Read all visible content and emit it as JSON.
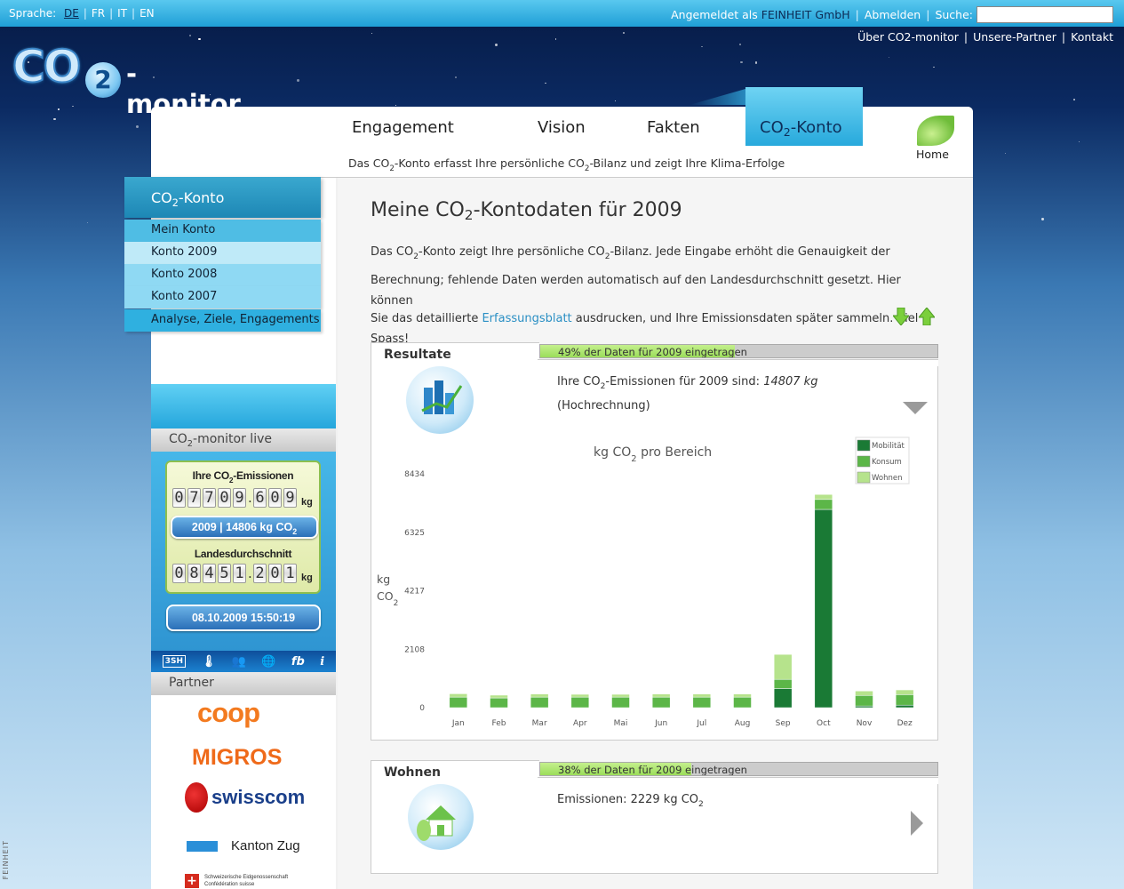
{
  "topbar": {
    "language_label": "Sprache:",
    "languages": [
      "DE",
      "FR",
      "IT",
      "EN"
    ],
    "logged_in_prefix": "Angemeldet als",
    "user": "FEINHEIT GmbH",
    "logout": "Abmelden",
    "search_label": "Suche:",
    "search_value": ""
  },
  "toplinks": [
    "Über CO2-monitor",
    "Unsere-Partner",
    "Kontakt"
  ],
  "logo": {
    "co": "CO",
    "two": "2",
    "monitor": "-monitor"
  },
  "nav": {
    "items": [
      "Engagement",
      "Vision",
      "Fakten"
    ],
    "active_prefix": "CO",
    "active_sub": "2",
    "active_suffix": "-Konto",
    "tagline": {
      "a": "Das CO",
      "b": "2",
      "c": "-Konto erfasst Ihre persönliche CO",
      "d": "2",
      "e": "-Bilanz und zeigt Ihre Klima-Erfolge"
    },
    "home": "Home"
  },
  "sidebar": {
    "head_a": "CO",
    "head_b": "2",
    "head_c": "-Konto",
    "items": [
      "Mein Konto",
      "Konto 2009",
      "Konto 2008",
      "Konto 2007",
      "Analyse, Ziele, Engagements"
    ]
  },
  "live": {
    "head_a": "CO",
    "head_b": "2",
    "head_c": "-monitor live",
    "emissions_title_a": "Ihre CO",
    "emissions_title_b": "2",
    "emissions_title_c": "-Emissionen",
    "emissions_digits": [
      "0",
      "7",
      "7",
      "0",
      "9",
      ".",
      "6",
      "0",
      "9"
    ],
    "unit": "kg",
    "year_pill_a": "2009 | 14806 kg CO",
    "year_pill_b": "2",
    "avg_title": "Landesdurchschnitt",
    "avg_digits": [
      "0",
      "8",
      "4",
      "5",
      "1",
      ".",
      "2",
      "0",
      "1"
    ],
    "date": "08.10.2009 15:50:19",
    "icons": [
      "3SH",
      "thermometer-icon",
      "people-icon",
      "globe-icon",
      "fb",
      "i"
    ]
  },
  "partners": {
    "head": "Partner",
    "logos": [
      "coop",
      "MIGROS",
      "swisscom",
      "Kanton Zug",
      "Schweizerische Eidgenossenschaft",
      "Confédération suisse"
    ]
  },
  "footer_vertical": "FEINHEIT",
  "main": {
    "title_a": "Meine CO",
    "title_b": "2",
    "title_c": "-Kontodaten für 2009",
    "intro_1a": "Das CO",
    "intro_1b": "2",
    "intro_1c": "-Konto zeigt Ihre persönliche CO",
    "intro_1d": "2",
    "intro_1e": "-Bilanz. Jede Eingabe erhöht die Genauigkeit der",
    "intro_2": "Berechnung; fehlende Daten werden automatisch auf den Landesdurchschnitt gesetzt. Hier können",
    "intro_3a": "Sie das detaillierte",
    "intro_3link": "Erfassungsblatt",
    "intro_3b": "ausdrucken, und Ihre Emissionsdaten später sammeln. Viel Spass!"
  },
  "results": {
    "head": "Resultate",
    "progress_label": "49% der Daten für 2009 eingetragen",
    "progress": 0.49,
    "line_a": "Ihre CO",
    "line_b": "2",
    "line_c": "-Emissionen für 2009 sind:",
    "value": "14807 kg",
    "line2": "(Hochrechnung)"
  },
  "wohnen": {
    "head": "Wohnen",
    "progress_label": "38% der Daten für 2009 eingetragen",
    "progress": 0.38,
    "line_a": "Emissionen: 2229 kg CO",
    "line_b": "2"
  },
  "colors": {
    "mobility": "#1a7a35",
    "consumption": "#5cb648",
    "housing": "#b6e38c",
    "accent": "#27a9dc"
  },
  "chart_data": {
    "type": "bar",
    "title_a": "kg CO",
    "title_b": "2",
    "title_c": " pro Bereich",
    "ylabel_a": "kg",
    "ylabel_b": "CO",
    "ylabel_c": "2",
    "yticks": [
      "8434",
      "6325",
      "4217",
      "2108",
      "0"
    ],
    "ylim": [
      0,
      8434
    ],
    "categories": [
      "Jan",
      "Feb",
      "Mar",
      "Apr",
      "Mai",
      "Jun",
      "Jul",
      "Aug",
      "Sep",
      "Oct",
      "Nov",
      "Dez"
    ],
    "series": [
      {
        "name": "Mobilität",
        "values": [
          0,
          0,
          0,
          0,
          0,
          0,
          0,
          0,
          690,
          7150,
          60,
          90
        ]
      },
      {
        "name": "Konsum",
        "values": [
          380,
          350,
          380,
          380,
          380,
          380,
          380,
          380,
          330,
          360,
          380,
          380
        ]
      },
      {
        "name": "Wohnen",
        "values": [
          120,
          100,
          110,
          100,
          100,
          110,
          110,
          110,
          900,
          180,
          160,
          170
        ]
      }
    ],
    "legend_position": "top-right"
  }
}
